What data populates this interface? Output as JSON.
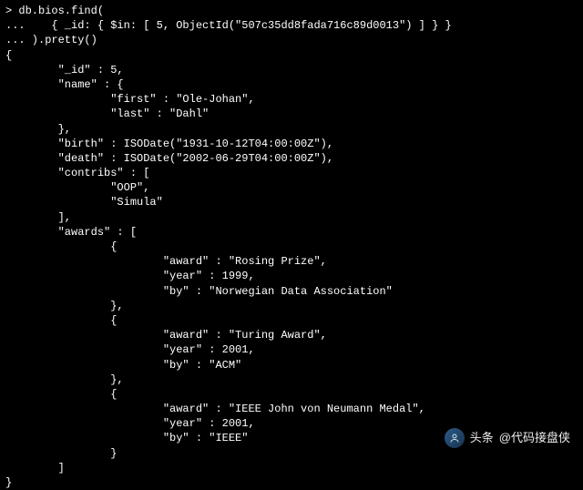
{
  "terminal": {
    "lines": [
      "> db.bios.find(",
      "...    { _id: { $in: [ 5, ObjectId(\"507c35dd8fada716c89d0013\") ] } }",
      "... ).pretty()",
      "{",
      "        \"_id\" : 5,",
      "        \"name\" : {",
      "                \"first\" : \"Ole-Johan\",",
      "                \"last\" : \"Dahl\"",
      "        },",
      "        \"birth\" : ISODate(\"1931-10-12T04:00:00Z\"),",
      "        \"death\" : ISODate(\"2002-06-29T04:00:00Z\"),",
      "        \"contribs\" : [",
      "                \"OOP\",",
      "                \"Simula\"",
      "        ],",
      "        \"awards\" : [",
      "                {",
      "                        \"award\" : \"Rosing Prize\",",
      "                        \"year\" : 1999,",
      "                        \"by\" : \"Norwegian Data Association\"",
      "                },",
      "                {",
      "                        \"award\" : \"Turing Award\",",
      "                        \"year\" : 2001,",
      "                        \"by\" : \"ACM\"",
      "                },",
      "                {",
      "                        \"award\" : \"IEEE John von Neumann Medal\",",
      "                        \"year\" : 2001,",
      "                        \"by\" : \"IEEE\"",
      "                }",
      "        ]",
      "}"
    ]
  },
  "chart_data": {
    "type": "table",
    "title": "MongoDB bios document (_id: 5)",
    "record": {
      "_id": 5,
      "name": {
        "first": "Ole-Johan",
        "last": "Dahl"
      },
      "birth": "1931-10-12T04:00:00Z",
      "death": "2002-06-29T04:00:00Z",
      "contribs": [
        "OOP",
        "Simula"
      ],
      "awards": [
        {
          "award": "Rosing Prize",
          "year": 1999,
          "by": "Norwegian Data Association"
        },
        {
          "award": "Turing Award",
          "year": 2001,
          "by": "ACM"
        },
        {
          "award": "IEEE John von Neumann Medal",
          "year": 2001,
          "by": "IEEE"
        }
      ]
    },
    "query": {
      "collection": "db.bios",
      "filter": "{ _id: { $in: [ 5, ObjectId(\"507c35dd8fada716c89d0013\") ] } }",
      "modifier": "pretty()"
    }
  },
  "watermark": {
    "platform": "头条",
    "handle": "@代码接盘侠"
  }
}
